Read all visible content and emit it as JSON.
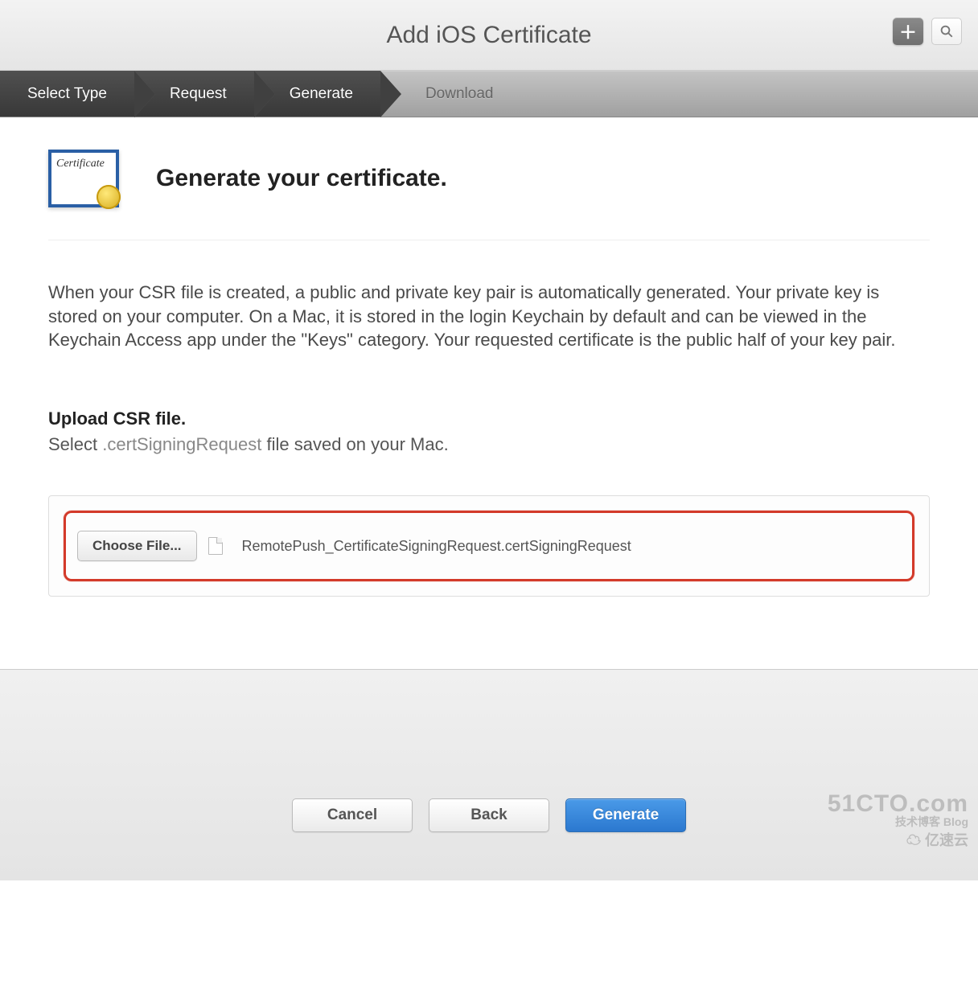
{
  "header": {
    "title": "Add iOS Certificate"
  },
  "steps": [
    {
      "label": "Select Type",
      "active": true
    },
    {
      "label": "Request",
      "active": true
    },
    {
      "label": "Generate",
      "active": true
    },
    {
      "label": "Download",
      "active": false
    }
  ],
  "gen": {
    "icon_word": "Certificate",
    "title": "Generate your certificate."
  },
  "body_text": "When your CSR file is created, a public and private key pair is automatically generated. Your private key is stored on your computer. On a Mac, it is stored in the login Keychain by default and can be viewed in the Keychain Access app under the \"Keys\" category. Your requested certificate is the public half of your key pair.",
  "upload": {
    "heading": "Upload CSR file.",
    "sub_a": "Select ",
    "sub_b": ".certSigningRequest",
    "sub_c": " file saved on your Mac.",
    "choose_label": "Choose File...",
    "filename": "RemotePush_CertificateSigningRequest.certSigningRequest"
  },
  "actions": {
    "cancel": "Cancel",
    "back": "Back",
    "generate": "Generate"
  },
  "watermark": {
    "l1": "51CTO.com",
    "l2": "技术博客  Blog",
    "l3": "亿速云"
  }
}
